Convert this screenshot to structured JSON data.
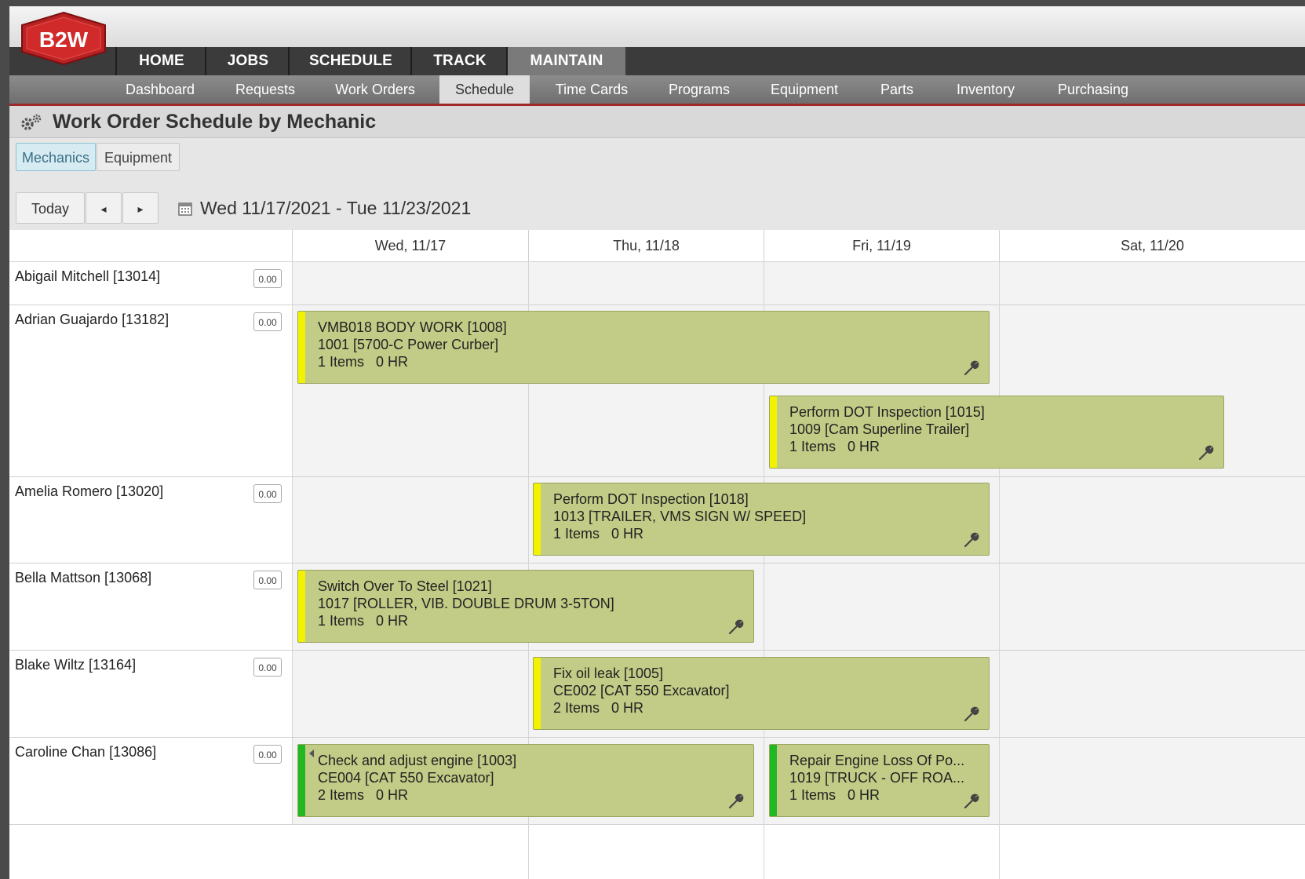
{
  "logo_text": "B2W",
  "main_nav": [
    {
      "label": "HOME"
    },
    {
      "label": "JOBS"
    },
    {
      "label": "SCHEDULE"
    },
    {
      "label": "TRACK"
    },
    {
      "label": "MAINTAIN",
      "active": true
    }
  ],
  "sub_nav": [
    {
      "label": "Dashboard"
    },
    {
      "label": "Requests"
    },
    {
      "label": "Work Orders"
    },
    {
      "label": "Schedule",
      "active": true
    },
    {
      "label": "Time Cards"
    },
    {
      "label": "Programs"
    },
    {
      "label": "Equipment"
    },
    {
      "label": "Parts"
    },
    {
      "label": "Inventory"
    },
    {
      "label": "Purchasing"
    }
  ],
  "page_title": "Work Order Schedule by Mechanic",
  "view_toggle": {
    "mechanics": "Mechanics",
    "equipment": "Equipment",
    "active": "Mechanics"
  },
  "date_nav": {
    "today": "Today",
    "prev": "◂",
    "next": "▸",
    "range": "Wed 11/17/2021 - Tue 11/23/2021"
  },
  "day_headers": [
    "Wed, 11/17",
    "Thu, 11/18",
    "Fri, 11/19",
    "Sat, 11/20"
  ],
  "mechanics": [
    {
      "name": "Abigail Mitchell [13014]",
      "hours": "0.00"
    },
    {
      "name": "Adrian Guajardo [13182]",
      "hours": "0.00"
    },
    {
      "name": "Amelia Romero [13020]",
      "hours": "0.00"
    },
    {
      "name": "Bella Mattson [13068]",
      "hours": "0.00"
    },
    {
      "name": "Blake Wiltz [13164]",
      "hours": "0.00"
    },
    {
      "name": "Caroline Chan [13086]",
      "hours": "0.00"
    }
  ],
  "events": [
    {
      "title": "VMB018 BODY WORK [1008]",
      "equipment": "1001 [5700-C Power Curber]",
      "summary": "1 Items   0 HR",
      "status_color": "#f2f200"
    },
    {
      "title": "Perform DOT Inspection [1015]",
      "equipment": "1009 [Cam Superline Trailer]",
      "summary": "1 Items   0 HR",
      "status_color": "#f2f200"
    },
    {
      "title": "Perform DOT Inspection [1018]",
      "equipment": "1013 [TRAILER, VMS SIGN W/ SPEED]",
      "summary": "1 Items   0 HR",
      "status_color": "#f2f200"
    },
    {
      "title": "Switch Over To Steel [1021]",
      "equipment": "1017 [ROLLER, VIB. DOUBLE DRUM 3-5TON]",
      "summary": "1 Items   0 HR",
      "status_color": "#f2f200"
    },
    {
      "title": "Fix oil leak [1005]",
      "equipment": "CE002 [CAT 550 Excavator]",
      "summary": "2 Items   0 HR",
      "status_color": "#f2f200"
    },
    {
      "title": "Check and adjust engine [1003]",
      "equipment": "CE004 [CAT 550 Excavator]",
      "summary": "2 Items   0 HR",
      "status_color": "#22b822"
    },
    {
      "title": "Repair Engine Loss Of Po...",
      "equipment": "1019 [TRUCK - OFF ROA...",
      "summary": "1 Items   0 HR",
      "status_color": "#22b822"
    }
  ]
}
